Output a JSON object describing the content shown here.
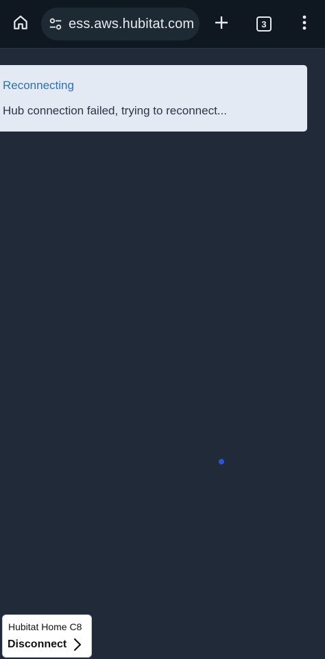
{
  "browser": {
    "url": "ess.aws.hubitat.com",
    "tab_count": "3",
    "icons": {
      "home": "home-icon",
      "site_settings": "tune-icon",
      "new_tab": "plus-icon",
      "tabs": "tab-switcher-icon",
      "menu": "more-vert-icon"
    }
  },
  "alert": {
    "title": "Reconnecting",
    "message": "Hub connection failed, trying to reconnect..."
  },
  "hub_card": {
    "hub_name": "Hubitat Home C8",
    "action_label": "Disconnect",
    "action_icon": "chevron-right-icon"
  },
  "colors": {
    "background": "#212a38",
    "toolbar": "#0f1720",
    "alert_background": "#e3eaf4",
    "alert_title": "#2f6fb5",
    "loading_dot": "#2a55d8"
  }
}
